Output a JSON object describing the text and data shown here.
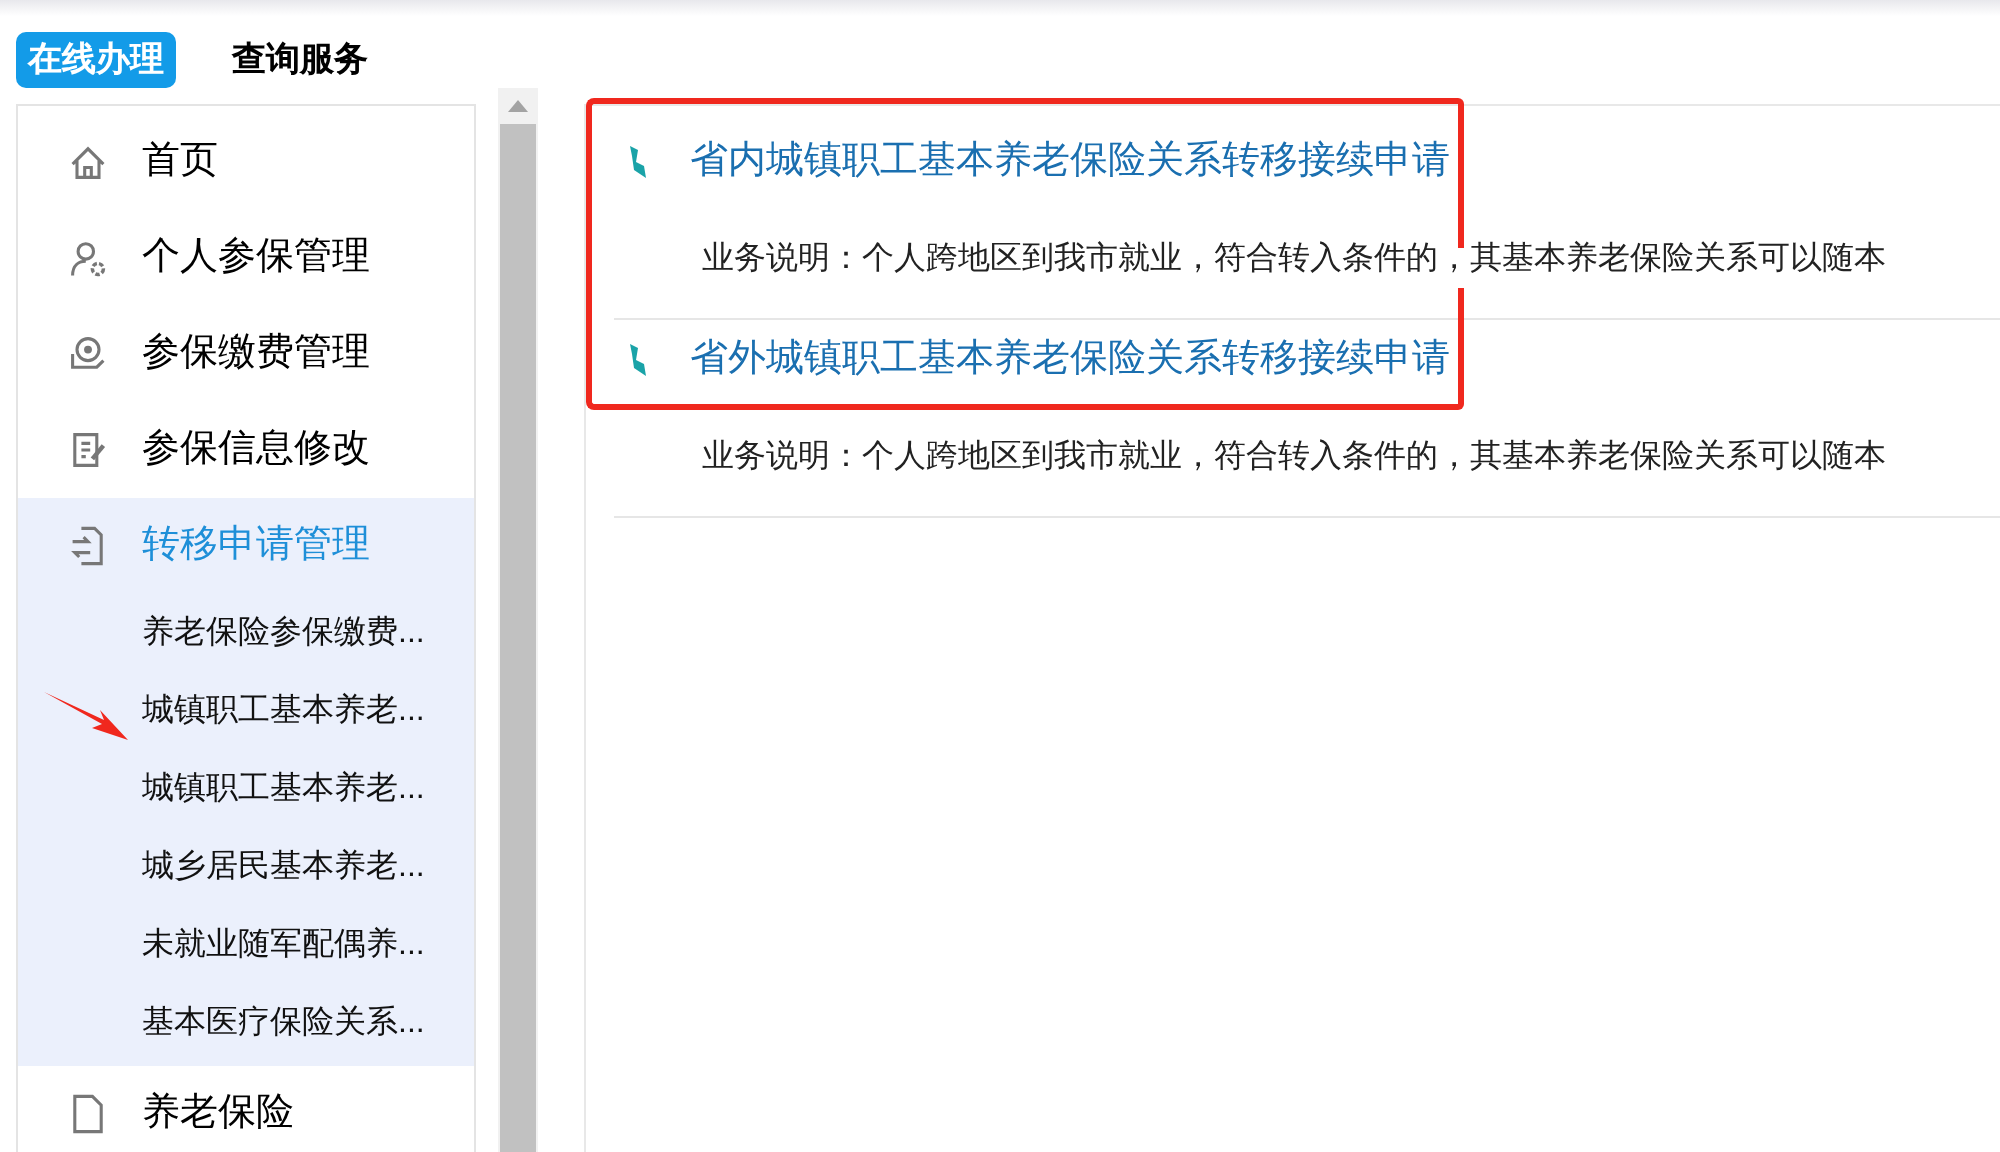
{
  "tabs": [
    {
      "label": "在线办理",
      "selected": true
    },
    {
      "label": "查询服务",
      "selected": false
    }
  ],
  "sidebar": {
    "items": [
      {
        "label": "首页",
        "kind": "home",
        "selected": false
      },
      {
        "label": "个人参保管理",
        "kind": "user",
        "selected": false
      },
      {
        "label": "参保缴费管理",
        "kind": "payment",
        "selected": false
      },
      {
        "label": "参保信息修改",
        "kind": "edit",
        "selected": false
      },
      {
        "label": "转移申请管理",
        "kind": "transfer",
        "selected": true,
        "expanded": true,
        "children": [
          {
            "label": "养老保险参保缴费..."
          },
          {
            "label": "城镇职工基本养老..."
          },
          {
            "label": "城镇职工基本养老..."
          },
          {
            "label": "城乡居民基本养老..."
          },
          {
            "label": "未就业随军配偶养..."
          },
          {
            "label": "基本医疗保险关系..."
          }
        ]
      },
      {
        "label": "养老保险",
        "kind": "document",
        "selected": false
      }
    ]
  },
  "services": [
    {
      "title": "省内城镇职工基本养老保险关系转移接续申请",
      "description": "业务说明：个人跨地区到我市就业，符合转入条件的，其基本养老保险关系可以随本"
    },
    {
      "title": "省外城镇职工基本养老保险关系转移接续申请",
      "description": "业务说明：个人跨地区到我市就业，符合转入条件的，其基本养老保险关系可以随本"
    }
  ]
}
